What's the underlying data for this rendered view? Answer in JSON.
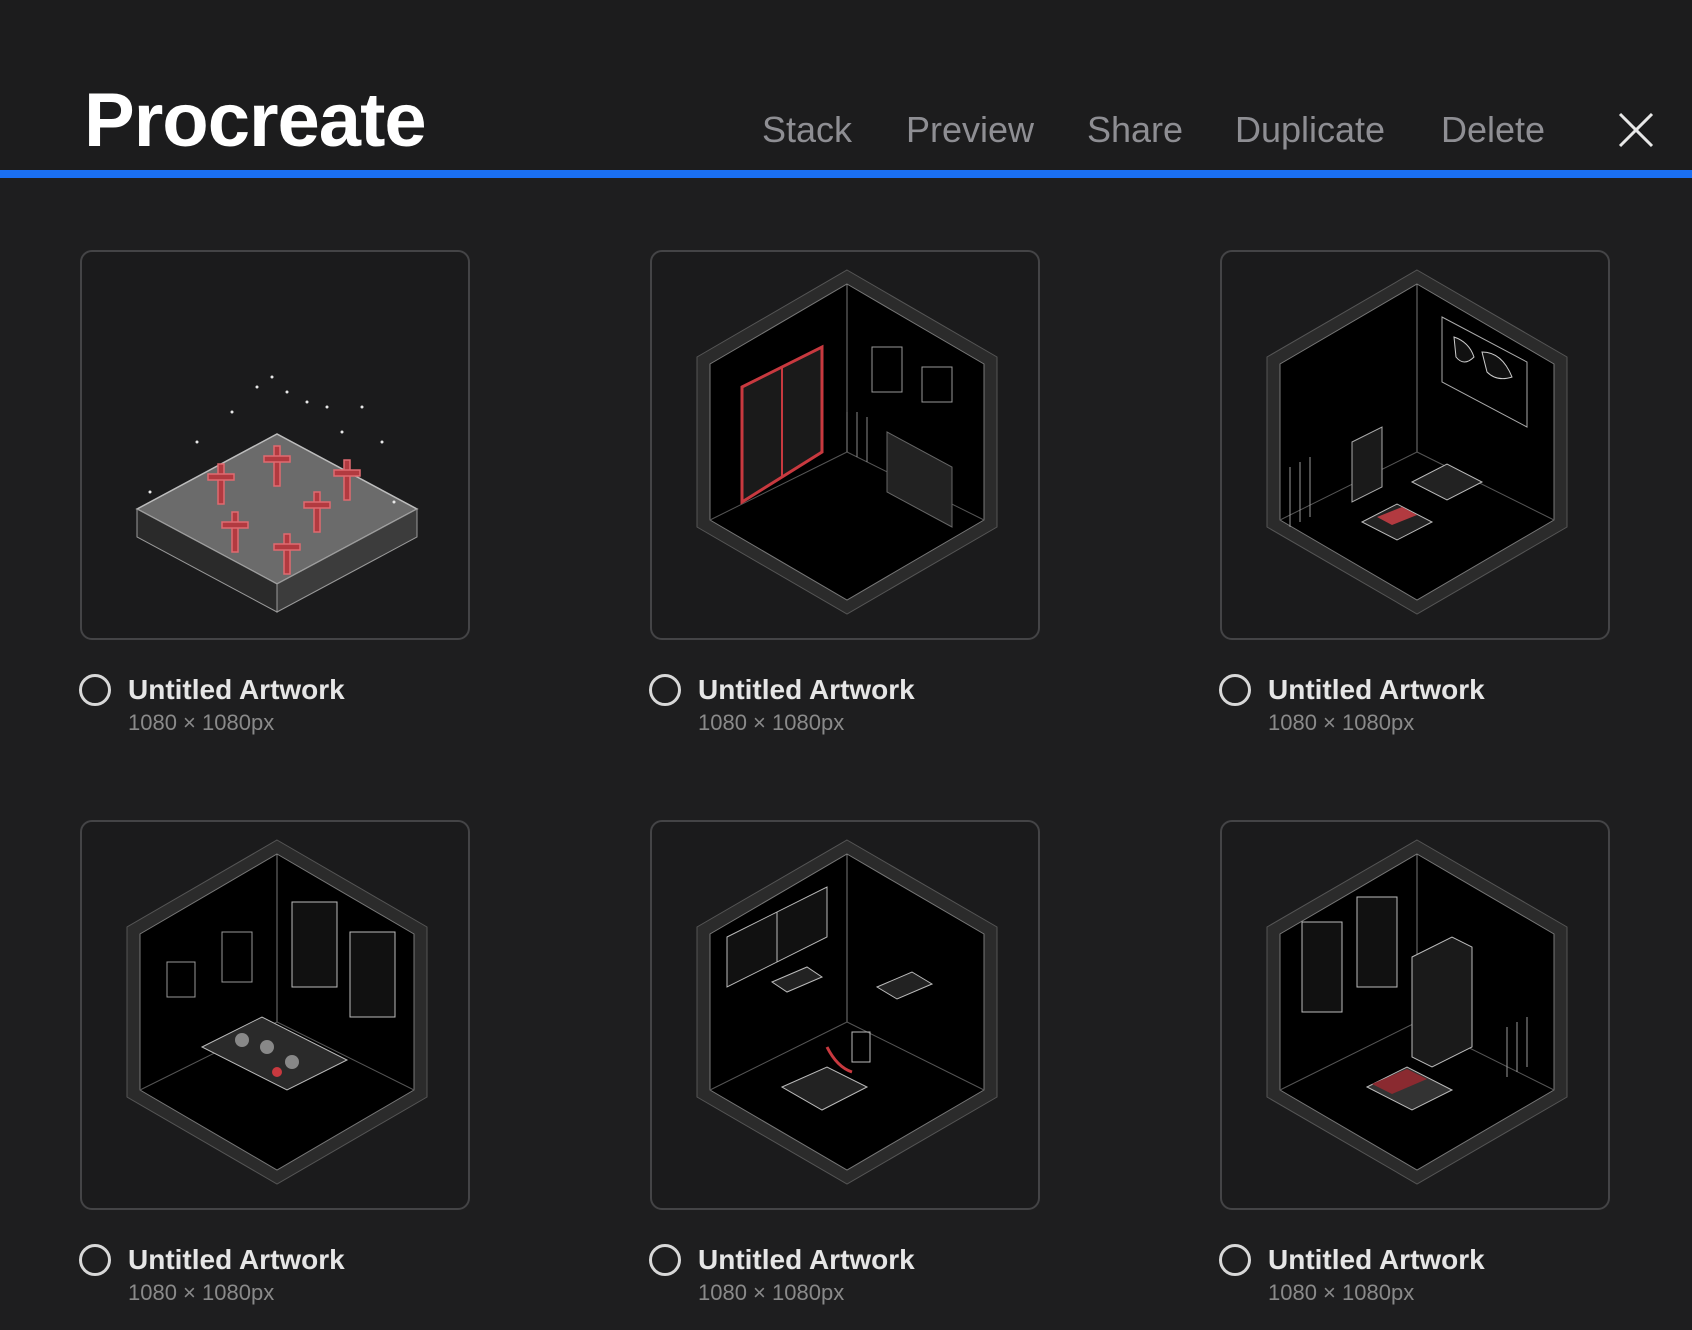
{
  "header": {
    "app_title": "Procreate",
    "actions": [
      "Stack",
      "Preview",
      "Share",
      "Duplicate",
      "Delete"
    ],
    "close_icon": "close-icon"
  },
  "colors": {
    "accent": "#1a6ff2",
    "background": "#1e1e1f",
    "drawing_red": "#c8393f"
  },
  "artworks": [
    {
      "title": "Untitled Artwork",
      "size": "1080 × 1080px",
      "thumbnail": "graveyard-crosses"
    },
    {
      "title": "Untitled Artwork",
      "size": "1080 × 1080px",
      "thumbnail": "room-red-door"
    },
    {
      "title": "Untitled Artwork",
      "size": "1080 × 1080px",
      "thumbnail": "classroom-desks-map"
    },
    {
      "title": "Untitled Artwork",
      "size": "1080 × 1080px",
      "thumbnail": "dining-room-windows"
    },
    {
      "title": "Untitled Artwork",
      "size": "1080 × 1080px",
      "thumbnail": "bathroom-tub-sinks"
    },
    {
      "title": "Untitled Artwork",
      "size": "1080 × 1080px",
      "thumbnail": "bedroom-wardrobe"
    }
  ]
}
